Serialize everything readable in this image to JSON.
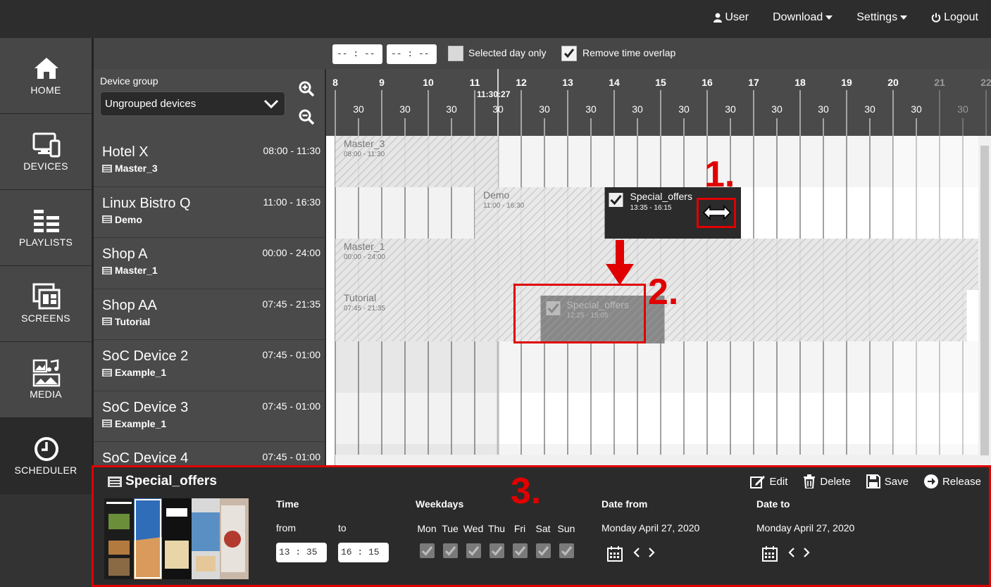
{
  "topnav": {
    "user": "User",
    "download": "Download",
    "settings": "Settings",
    "logout": "Logout"
  },
  "sidebar": {
    "items": [
      {
        "label": "HOME",
        "icon": "home-icon"
      },
      {
        "label": "DEVICES",
        "icon": "devices-icon"
      },
      {
        "label": "PLAYLISTS",
        "icon": "playlists-icon"
      },
      {
        "label": "SCREENS",
        "icon": "screens-icon"
      },
      {
        "label": "MEDIA",
        "icon": "media-icon"
      },
      {
        "label": "SCHEDULER",
        "icon": "clock-icon"
      }
    ]
  },
  "toolbar": {
    "time_from_placeholder": "-- : --",
    "time_to_placeholder": "-- : --",
    "selected_day_only": "Selected day only",
    "remove_time_overlap": "Remove time overlap",
    "selected_day_checked": false,
    "remove_overlap_checked": true
  },
  "device_group": {
    "title": "Device group",
    "selected": "Ungrouped devices"
  },
  "devices": [
    {
      "name": "Hotel X",
      "time": "08:00 - 11:30",
      "playlist": "Master_3"
    },
    {
      "name": "Linux Bistro Q",
      "time": "11:00 - 16:30",
      "playlist": "Demo"
    },
    {
      "name": "Shop A",
      "time": "00:00 - 24:00",
      "playlist": "Master_1"
    },
    {
      "name": "Shop AA",
      "time": "07:45 - 21:35",
      "playlist": "Tutorial"
    },
    {
      "name": "SoC Device 2",
      "time": "07:45 - 01:00",
      "playlist": "Example_1"
    },
    {
      "name": "SoC Device 3",
      "time": "07:45 - 01:00",
      "playlist": "Example_1"
    },
    {
      "name": "SoC Device 4",
      "time": "07:45 - 01:00",
      "playlist": ""
    }
  ],
  "timeline": {
    "hours": [
      "8",
      "9",
      "10",
      "11",
      "12",
      "13",
      "14",
      "15",
      "16",
      "17",
      "18",
      "19",
      "20",
      "21",
      "22"
    ],
    "half_label": "30",
    "current_time": "11:30:27",
    "blocks": [
      {
        "row": 0,
        "name": "Master_3",
        "time": "08:00 - 11:30"
      },
      {
        "row": 1,
        "name": "Demo",
        "time": "11:00 - 16:30"
      },
      {
        "row": 2,
        "name": "Master_1",
        "time": "00:00 - 24:00"
      },
      {
        "row": 3,
        "name": "Tutorial",
        "time": "07:45 - 21:35"
      }
    ],
    "active_block": {
      "name": "Special_offers",
      "time": "13:35 - 16:15"
    },
    "ghost_block": {
      "name": "Special_offers",
      "time": "12:25 - 15:05"
    }
  },
  "details": {
    "title": "Special_offers",
    "actions": {
      "edit": "Edit",
      "delete": "Delete",
      "save": "Save",
      "release": "Release"
    },
    "time_heading": "Time",
    "from_label": "from",
    "to_label": "to",
    "from_value": "13 : 35",
    "to_value": "16 : 15",
    "weekdays_heading": "Weekdays",
    "weekdays": [
      "Mon",
      "Tue",
      "Wed",
      "Thu",
      "Fri",
      "Sat",
      "Sun"
    ],
    "date_from_heading": "Date from",
    "date_from_value": "Monday April 27, 2020",
    "date_to_heading": "Date to",
    "date_to_value": "Monday April 27, 2020"
  },
  "annotations": {
    "one": "1.",
    "two": "2.",
    "three": "3."
  },
  "colors": {
    "accent_red": "#e00000",
    "panel_dark": "#2b2b2b",
    "sidebar_gray": "#474747"
  }
}
